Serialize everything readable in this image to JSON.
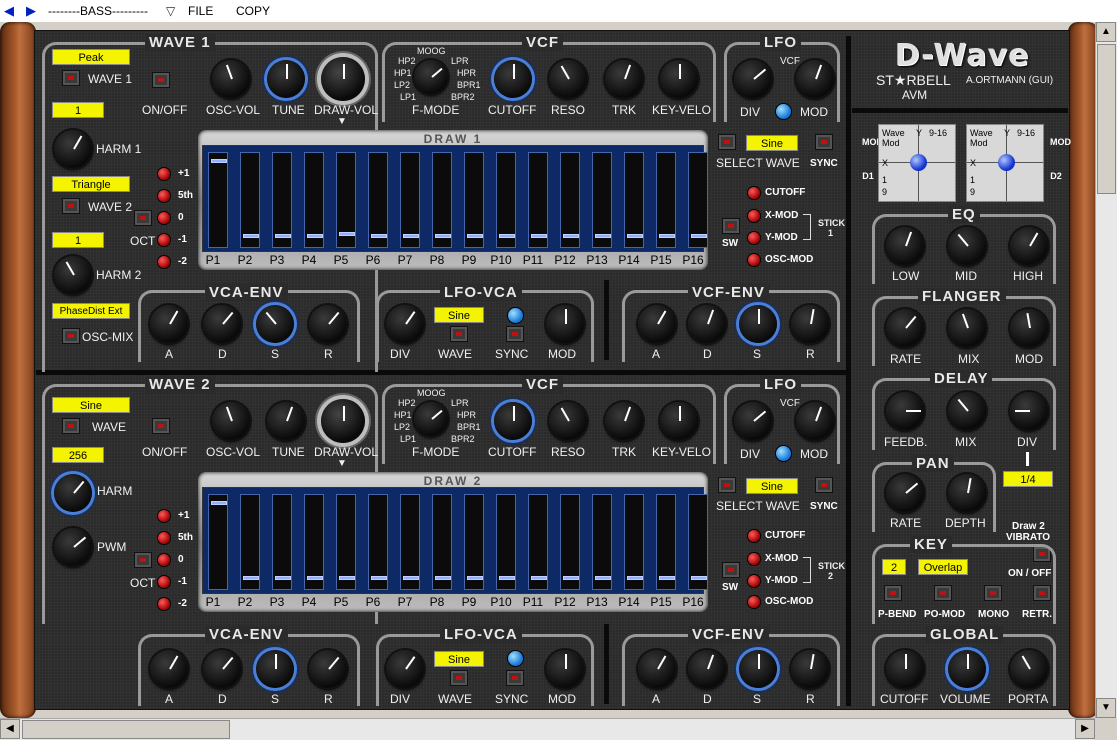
{
  "toolbar": {
    "preset": "--------BASS---------",
    "file": "FILE",
    "copy": "COPY"
  },
  "logo": {
    "title": "D-Wave",
    "brand": "ST★RBELL",
    "sub": "AVM",
    "gui": "A.ORTMANN (GUI)"
  },
  "osc1": {
    "title": "WAVE 1",
    "wave": "Peak",
    "wave_label": "WAVE 1",
    "onoff": "ON/OFF",
    "harm_value": "1",
    "harm_label": "HARM 1",
    "wave2": "Triangle",
    "wave2_label": "WAVE 2",
    "harm2_value": "1",
    "harm2_label": "HARM 2",
    "oscmix": "PhaseDist Ext",
    "oscmix_label": "OSC-MIX",
    "oct": "OCT",
    "oct_levels": [
      "+1",
      "5th",
      "0",
      "-1",
      "-2"
    ],
    "osc_vol": "OSC-VOL",
    "tune": "TUNE",
    "draw_vol": "DRAW-VOL",
    "vcf": {
      "title": "VCF",
      "modes": [
        "MOOG",
        "HP2",
        "HP1",
        "LP2",
        "LP1",
        "LPR",
        "HPR",
        "BPR1",
        "BPR2"
      ],
      "fmode": "F-MODE",
      "cutoff": "CUTOFF",
      "reso": "RESO",
      "trk": "TRK",
      "keyvelo": "KEY-VELO"
    },
    "lfo": {
      "title": "LFO",
      "vcf": "VCF",
      "div": "DIV",
      "mod": "MOD"
    },
    "draw": {
      "title": "DRAW 1",
      "select": "Sine",
      "select_label": "SELECT WAVE",
      "sync": "SYNC",
      "sw": "SW",
      "cutoff": "CUTOFF",
      "xmod": "X-MOD",
      "ymod": "Y-MOD",
      "stick": "STICK",
      "stick_n": "1",
      "oscmod": "OSC-MOD",
      "levels": [
        0.95,
        0.08,
        0.08,
        0.08,
        0.1,
        0.08,
        0.08,
        0.08,
        0.08,
        0.08,
        0.08,
        0.08,
        0.08,
        0.08,
        0.08,
        0.08
      ]
    },
    "vcaenv": {
      "title": "VCA-ENV",
      "a": "A",
      "d": "D",
      "s": "S",
      "r": "R"
    },
    "lfovca": {
      "title": "LFO-VCA",
      "wave": "Sine",
      "div": "DIV",
      "wave_label": "WAVE",
      "sync": "SYNC",
      "mod": "MOD"
    },
    "vcfenv": {
      "title": "VCF-ENV",
      "a": "A",
      "d": "D",
      "s": "S",
      "r": "R"
    }
  },
  "osc2": {
    "title": "WAVE 2",
    "wave": "Sine",
    "wave_label": "WAVE",
    "onoff": "ON/OFF",
    "harm_value": "256",
    "harm_label": "HARM",
    "pwm_label": "PWM",
    "oct": "OCT",
    "oct_levels": [
      "+1",
      "5th",
      "0",
      "-1",
      "-2"
    ],
    "osc_vol": "OSC-VOL",
    "tune": "TUNE",
    "draw_vol": "DRAW-VOL",
    "vcf": {
      "title": "VCF",
      "modes": [
        "MOOG",
        "HP2",
        "HP1",
        "LP2",
        "LP1",
        "LPR",
        "HPR",
        "BPR1",
        "BPR2"
      ],
      "fmode": "F-MODE",
      "cutoff": "CUTOFF",
      "reso": "RESO",
      "trk": "TRK",
      "keyvelo": "KEY-VELO"
    },
    "lfo": {
      "title": "LFO",
      "vcf": "VCF",
      "div": "DIV",
      "mod": "MOD"
    },
    "draw": {
      "title": "DRAW 2",
      "select": "Sine",
      "select_label": "SELECT WAVE",
      "sync": "SYNC",
      "sw": "SW",
      "cutoff": "CUTOFF",
      "xmod": "X-MOD",
      "ymod": "Y-MOD",
      "stick": "STICK",
      "stick_n": "2",
      "oscmod": "OSC-MOD",
      "levels": [
        0.95,
        0.08,
        0.08,
        0.08,
        0.08,
        0.08,
        0.08,
        0.08,
        0.08,
        0.08,
        0.08,
        0.08,
        0.08,
        0.08,
        0.08,
        0.08
      ]
    },
    "vcaenv": {
      "title": "VCA-ENV",
      "a": "A",
      "d": "D",
      "s": "S",
      "r": "R"
    },
    "lfovca": {
      "title": "LFO-VCA",
      "wave": "Sine",
      "div": "DIV",
      "wave_label": "WAVE",
      "sync": "SYNC",
      "mod": "MOD"
    },
    "vcfenv": {
      "title": "VCF-ENV",
      "a": "A",
      "d": "D",
      "s": "S",
      "r": "R"
    }
  },
  "partials": [
    "P1",
    "P2",
    "P3",
    "P4",
    "P5",
    "P6",
    "P7",
    "P8",
    "P9",
    "P10",
    "P11",
    "P12",
    "P13",
    "P14",
    "P15",
    "P16"
  ],
  "mod": {
    "mod": "MOD",
    "d1": "D1",
    "d2": "D2",
    "wave": "Wave",
    "modtxt": "Mod",
    "y": "Y",
    "range": "9-16",
    "x": "X",
    "r1": "1",
    "r9": "9"
  },
  "eq": {
    "title": "EQ",
    "low": "LOW",
    "mid": "MID",
    "high": "HIGH"
  },
  "flanger": {
    "title": "FLANGER",
    "rate": "RATE",
    "mix": "MIX",
    "mod": "MOD"
  },
  "delay": {
    "title": "DELAY",
    "feedb": "FEEDB.",
    "mix": "MIX",
    "div": "DIV",
    "div_value": "1/4"
  },
  "pan": {
    "title": "PAN",
    "rate": "RATE",
    "depth": "DEPTH"
  },
  "vibrato": {
    "line1": "Draw 2",
    "line2": "VIBRATO",
    "onoff": "ON / OFF"
  },
  "key": {
    "title": "KEY",
    "value": "2",
    "mode": "Overlap",
    "pbend": "P-BEND",
    "pomod": "PO-MOD",
    "mono": "MONO",
    "retr": "RETR."
  },
  "global": {
    "title": "GLOBAL",
    "cutoff": "CUTOFF",
    "volume": "VOLUME",
    "porta": "PORTA"
  },
  "colors": {
    "accent_yellow": "#f4f400",
    "led_red": "#c21010",
    "led_blue": "#1878d8",
    "ring_blue": "#4a7fd8"
  },
  "icons": [
    "arrow-left-icon",
    "arrow-right-icon",
    "triangle-down-icon"
  ]
}
